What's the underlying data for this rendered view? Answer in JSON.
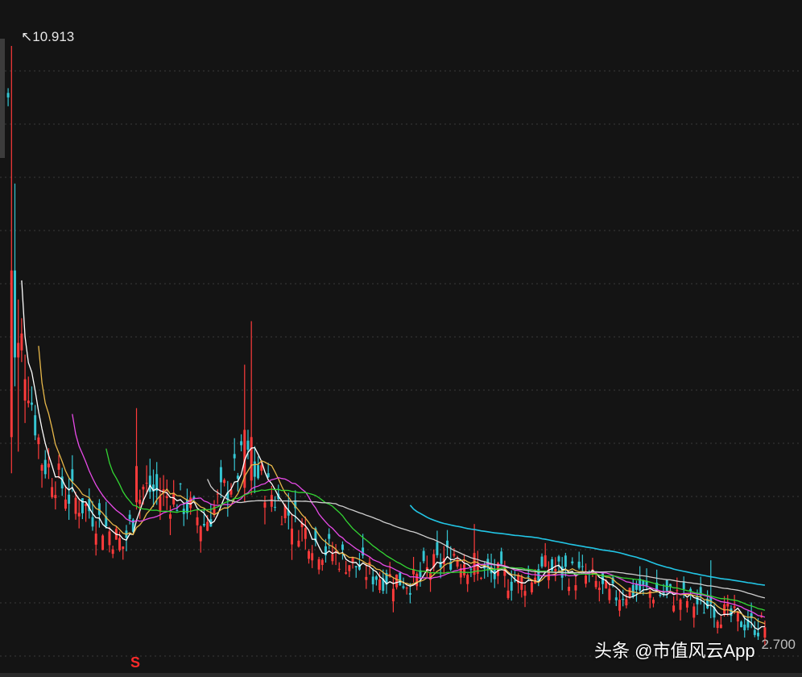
{
  "chart_data": {
    "type": "candlestick",
    "price_max_label": "↖10.913",
    "price_min_label": "2.700",
    "signal_marker": "S",
    "ylim": [
      2.5,
      11.2
    ],
    "grid": true,
    "up_color": "#ff3b3b",
    "down_color": "#35c6d3",
    "series": [
      {
        "id": "ma5",
        "color": "#ffffff"
      },
      {
        "id": "ma10",
        "color": "#e8b84a"
      },
      {
        "id": "ma20",
        "color": "#e84ae8"
      },
      {
        "id": "ma30",
        "color": "#33d633"
      },
      {
        "id": "ma60",
        "color": "#cfcfcf"
      },
      {
        "id": "ma120",
        "color": "#22c6e6"
      }
    ],
    "close_trend": [
      [
        0,
        10.2
      ],
      [
        4,
        6.8
      ],
      [
        10,
        5.2
      ],
      [
        18,
        4.7
      ],
      [
        24,
        4.5
      ],
      [
        34,
        4.0
      ],
      [
        40,
        4.8
      ],
      [
        52,
        4.6
      ],
      [
        58,
        4.3
      ],
      [
        70,
        5.2
      ],
      [
        80,
        4.6
      ],
      [
        92,
        4.0
      ],
      [
        108,
        3.6
      ],
      [
        120,
        3.5
      ],
      [
        132,
        3.9
      ],
      [
        142,
        3.6
      ],
      [
        152,
        3.5
      ],
      [
        160,
        3.7
      ],
      [
        172,
        3.55
      ],
      [
        178,
        3.3
      ],
      [
        186,
        3.4
      ],
      [
        198,
        3.3
      ],
      [
        210,
        3.1
      ],
      [
        220,
        2.9
      ]
    ]
  },
  "watermark": "头条 @市值风云App"
}
